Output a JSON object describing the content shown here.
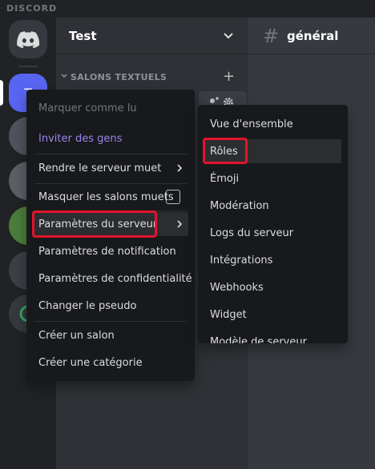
{
  "app": {
    "brand": "DISCORD"
  },
  "server": {
    "name": "Test",
    "initial": "T"
  },
  "sidebar": {
    "category_label": "SALONS TEXTUELS"
  },
  "channel": {
    "name": "général"
  },
  "context_menu": {
    "items": [
      {
        "label": "Marquer comme lu",
        "state": "disabled"
      },
      {
        "label": "Inviter des gens",
        "state": "accent"
      },
      {
        "label": "Rendre le serveur muet",
        "has_submenu": true
      },
      {
        "label": "Masquer les salons muets",
        "checkbox": true,
        "checked": false
      },
      {
        "label": "Paramètres du serveur",
        "has_submenu": true,
        "highlighted": true
      },
      {
        "label": "Paramètres de notification"
      },
      {
        "label": "Paramètres de confidentialité"
      },
      {
        "label": "Changer le pseudo"
      },
      {
        "label": "Créer un salon"
      },
      {
        "label": "Créer une catégorie"
      }
    ]
  },
  "submenu": {
    "items": [
      {
        "label": "Vue d'ensemble"
      },
      {
        "label": "Rôles",
        "highlighted": true
      },
      {
        "label": "Émoji"
      },
      {
        "label": "Modération"
      },
      {
        "label": "Logs du serveur"
      },
      {
        "label": "Intégrations"
      },
      {
        "label": "Webhooks"
      },
      {
        "label": "Widget"
      },
      {
        "label": "Modèle de serveur"
      }
    ]
  },
  "colors": {
    "accent": "#9b84ee",
    "blurple": "#5865f2",
    "annotation_red": "#e3142b",
    "menu_bg": "#18191c"
  }
}
